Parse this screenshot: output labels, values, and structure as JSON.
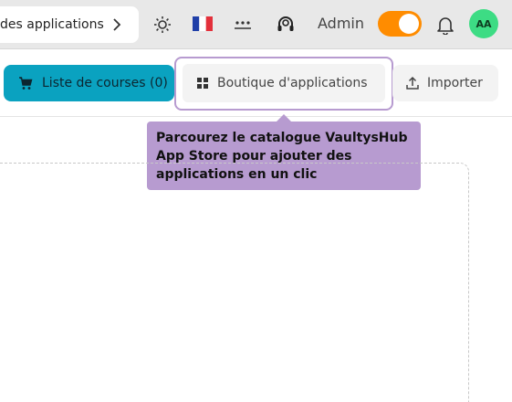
{
  "topbar": {
    "breadcrumb": "des applications",
    "admin_label": "Admin",
    "avatar_initials": "AA",
    "language_flag": "fr",
    "toggle_on": true,
    "toggle_color": "#ff8c00"
  },
  "toolbar": {
    "cart_label": "Liste de courses (0)",
    "store_label": "Boutique d'applications",
    "import_label": "Importer",
    "cart_color": "#0aa2c0"
  },
  "tooltip": {
    "text": "Parcourez le catalogue VaultysHub App Store pour ajouter des applications en un clic",
    "color": "#b79bd0"
  }
}
